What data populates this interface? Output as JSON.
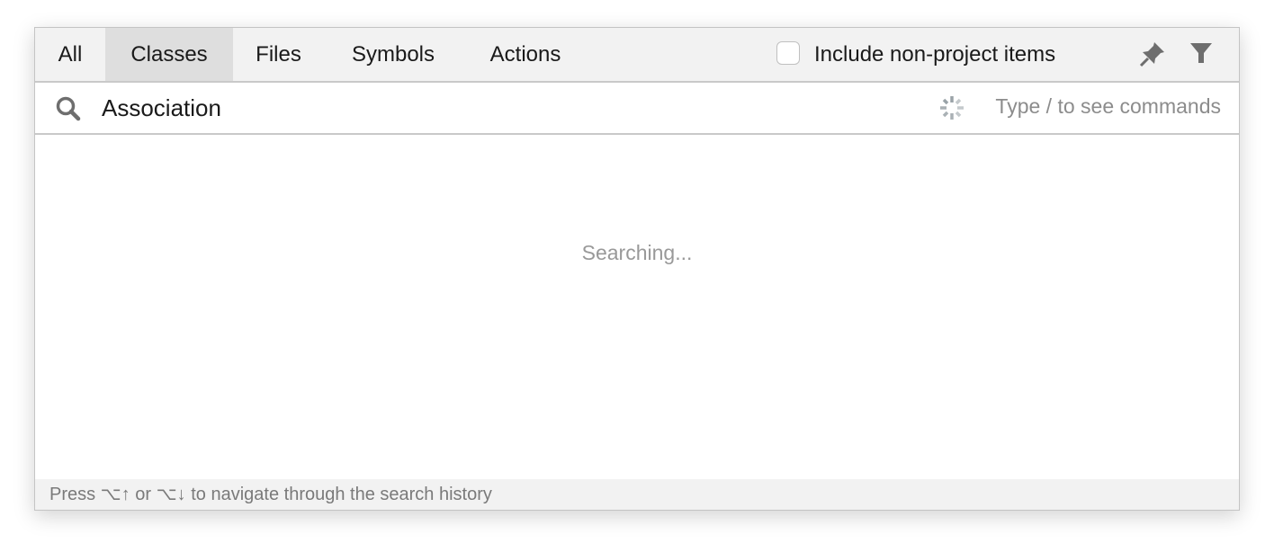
{
  "tabs": [
    {
      "label": "All",
      "active": false
    },
    {
      "label": "Classes",
      "active": true
    },
    {
      "label": "Files",
      "active": false
    },
    {
      "label": "Symbols",
      "active": false
    },
    {
      "label": "Actions",
      "active": false
    }
  ],
  "options": {
    "include_non_project_label": "Include non-project items",
    "include_non_project_checked": false
  },
  "icons": {
    "pin": "pin-icon",
    "filter": "filter-icon",
    "search": "search-icon",
    "spinner": "spinner-icon"
  },
  "search": {
    "value": "Association",
    "hint": "Type / to see commands"
  },
  "results": {
    "status": "Searching..."
  },
  "footer": {
    "text": "Press ⌥↑ or ⌥↓ to navigate through the search history"
  }
}
